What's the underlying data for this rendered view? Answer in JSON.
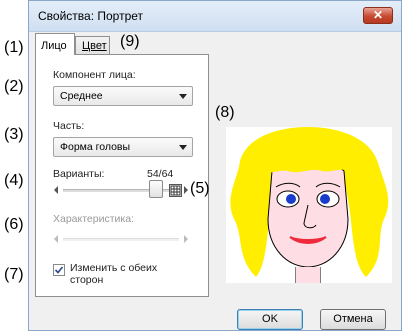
{
  "window": {
    "title": "Свойства: Портрет",
    "close_glyph": "✕"
  },
  "tabs": [
    {
      "label": "Лицо",
      "active": true
    },
    {
      "label": "Цвет",
      "active": false
    }
  ],
  "face_panel": {
    "component_label": "Компонент лица:",
    "component_value": "Среднее",
    "part_label": "Часть:",
    "part_value": "Форма головы",
    "variants_label": "Варианты:",
    "variants_counter": "54/64",
    "variants_level": 0.84,
    "characteristic_label": "Характеристика:",
    "both_sides_label": "Изменить с обеих сторон",
    "both_sides_checked": true
  },
  "buttons": {
    "ok": "OK",
    "cancel": "Отмена"
  },
  "callouts": [
    "(1)",
    "(2)",
    "(3)",
    "(4)",
    "(5)",
    "(6)",
    "(7)",
    "(8)",
    "(9)"
  ],
  "colors": {
    "hair": "#ffee00",
    "skin": "#ffdde4",
    "eyes": "#1a3ccc",
    "lips": "#ee2a3c",
    "close_button": "#c74a31"
  },
  "icons": [
    "close-icon",
    "chevron-down-icon",
    "arrow-left-icon",
    "arrow-right-icon",
    "grid-icon",
    "checkmark-icon"
  ]
}
